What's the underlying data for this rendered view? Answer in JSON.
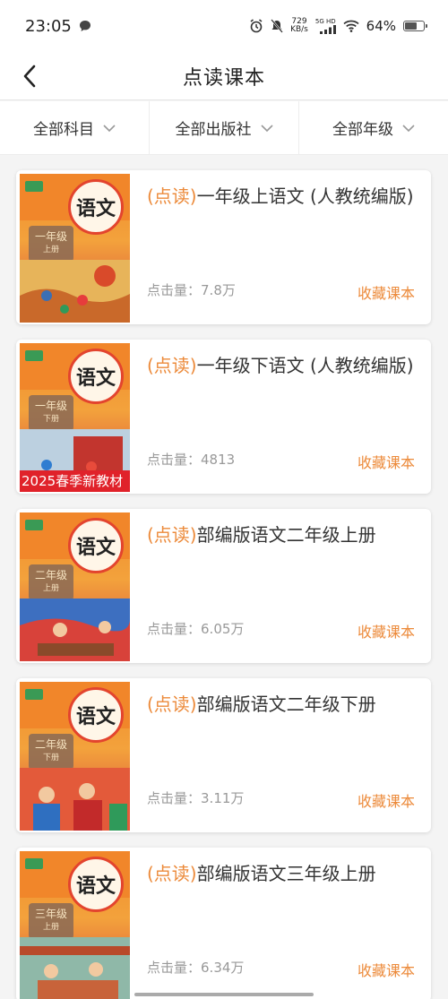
{
  "status": {
    "time": "23:05",
    "net_speed": "729",
    "net_unit": "KB/s",
    "sig_label": "5G HD",
    "battery": "64%",
    "battery_level": 0.64
  },
  "nav": {
    "title": "点读课本"
  },
  "filters": [
    {
      "label": "全部科目"
    },
    {
      "label": "全部出版社"
    },
    {
      "label": "全部年级"
    }
  ],
  "books": [
    {
      "tag": "(点读)",
      "title": "一年级上语文 (人教统编版)",
      "clicks_label": "点击量：",
      "clicks": "7.8万",
      "collect": "收藏课本",
      "grade": "一年级",
      "term": "上册",
      "banner": ""
    },
    {
      "tag": "(点读)",
      "title": "一年级下语文 (人教统编版)",
      "clicks_label": "点击量：",
      "clicks": "4813",
      "collect": "收藏课本",
      "grade": "一年级",
      "term": "下册",
      "banner": "2025春季新教材"
    },
    {
      "tag": "(点读)",
      "title": "部编版语文二年级上册",
      "clicks_label": "点击量：",
      "clicks": "6.05万",
      "collect": "收藏课本",
      "grade": "二年级",
      "term": "上册",
      "banner": ""
    },
    {
      "tag": "(点读)",
      "title": "部编版语文二年级下册",
      "clicks_label": "点击量：",
      "clicks": "3.11万",
      "collect": "收藏课本",
      "grade": "二年级",
      "term": "下册",
      "banner": ""
    },
    {
      "tag": "(点读)",
      "title": "部编版语文三年级上册",
      "clicks_label": "点击量：",
      "clicks": "6.34万",
      "collect": "收藏课本",
      "grade": "三年级",
      "term": "上册",
      "banner": ""
    }
  ],
  "cover_seal_text": "语文",
  "colors": {
    "accent": "#ec8a3a",
    "cover_orange": "#f1862a",
    "banner_red": "#e0222a"
  }
}
